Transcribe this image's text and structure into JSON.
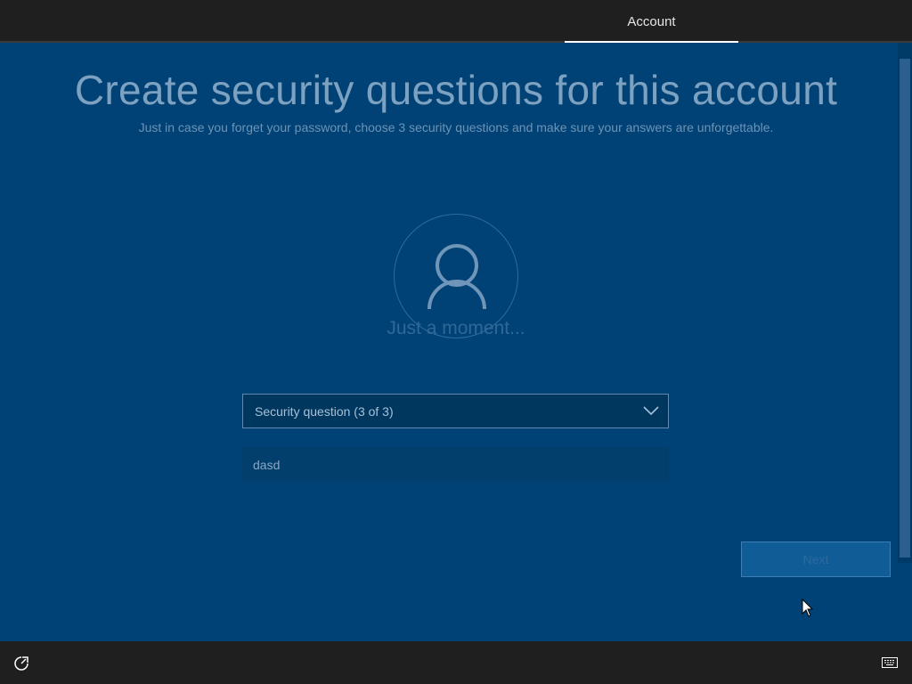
{
  "header": {
    "tabs": [
      {
        "label": "Account",
        "active": true
      }
    ]
  },
  "page": {
    "title": "Create security questions for this account",
    "subtitle": "Just in case you forget your password, choose 3 security questions and make sure your answers are unforgettable.",
    "loading_text": "Just a moment..."
  },
  "form": {
    "question_dropdown": {
      "selected": "Security question (3 of 3)"
    },
    "answer_field": {
      "value": "dasd"
    }
  },
  "footer": {
    "next_label": "Next",
    "icons": [
      "ease-of-access-icon",
      "keyboard-icon"
    ]
  },
  "colors": {
    "background": "#004275",
    "bar": "#1f1f1f",
    "accent": "#0f5c97"
  }
}
